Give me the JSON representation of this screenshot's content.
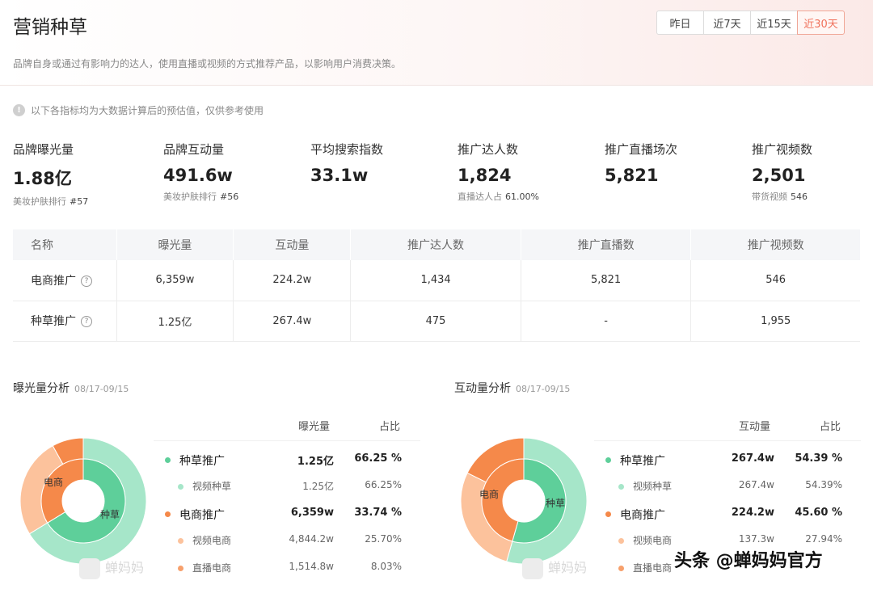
{
  "header": {
    "title": "营销种草",
    "subtitle": "品牌自身或通过有影响力的达人，使用直播或视频的方式推荐产品，以影响用户消费决策。",
    "range_tabs": [
      {
        "label": "昨日",
        "active": false
      },
      {
        "label": "近7天",
        "active": false
      },
      {
        "label": "近15天",
        "active": false
      },
      {
        "label": "近30天",
        "active": true
      }
    ]
  },
  "notice": "以下各指标均为大数据计算后的预估值，仅供参考使用",
  "metrics": [
    {
      "label": "品牌曝光量",
      "value": "1.88亿",
      "sub_label": "美妆护肤排行",
      "sub_value": "#57"
    },
    {
      "label": "品牌互动量",
      "value": "491.6w",
      "sub_label": "美妆护肤排行",
      "sub_value": "#56"
    },
    {
      "label": "平均搜索指数",
      "value": "33.1w",
      "sub_label": "",
      "sub_value": ""
    },
    {
      "label": "推广达人数",
      "value": "1,824",
      "sub_label": "直播达人占",
      "sub_value": "61.00%"
    },
    {
      "label": "推广直播场次",
      "value": "5,821",
      "sub_label": "",
      "sub_value": ""
    },
    {
      "label": "推广视频数",
      "value": "2,501",
      "sub_label": "带货视频",
      "sub_value": "546"
    }
  ],
  "table": {
    "headers": [
      "名称",
      "曝光量",
      "互动量",
      "推广达人数",
      "推广直播数",
      "推广视频数"
    ],
    "rows": [
      [
        "电商推广",
        "6,359w",
        "224.2w",
        "1,434",
        "5,821",
        "546"
      ],
      [
        "种草推广",
        "1.25亿",
        "267.4w",
        "475",
        "-",
        "1,955"
      ]
    ],
    "help_icon": "?"
  },
  "exposure": {
    "title": "曝光量分析",
    "date": "08/17-09/15",
    "col_value": "曝光量",
    "col_pct": "占比",
    "inner_label_a": "电商",
    "inner_label_b": "种草",
    "rows": [
      {
        "name": "种草推广",
        "value": "1.25亿",
        "pct": "66.25 %",
        "level": "main",
        "color": "#5ecf9a"
      },
      {
        "name": "视频种草",
        "value": "1.25亿",
        "pct": "66.25%",
        "level": "sub",
        "color": "#a6e6c9"
      },
      {
        "name": "电商推广",
        "value": "6,359w",
        "pct": "33.74 %",
        "level": "main",
        "color": "#f5894a"
      },
      {
        "name": "视频电商",
        "value": "4,844.2w",
        "pct": "25.70%",
        "level": "sub",
        "color": "#fcc29c"
      },
      {
        "name": "直播电商",
        "value": "1,514.8w",
        "pct": "8.03%",
        "level": "sub",
        "color": "#f7a06c"
      }
    ],
    "inner": [
      66.25,
      33.74
    ],
    "outer": [
      66.25,
      25.7,
      8.03
    ]
  },
  "interaction": {
    "title": "互动量分析",
    "date": "08/17-09/15",
    "col_value": "互动量",
    "col_pct": "占比",
    "inner_label_a": "电商",
    "inner_label_b": "种草",
    "rows": [
      {
        "name": "种草推广",
        "value": "267.4w",
        "pct": "54.39 %",
        "level": "main",
        "color": "#5ecf9a"
      },
      {
        "name": "视频种草",
        "value": "267.4w",
        "pct": "54.39%",
        "level": "sub",
        "color": "#a6e6c9"
      },
      {
        "name": "电商推广",
        "value": "224.2w",
        "pct": "45.60 %",
        "level": "main",
        "color": "#f5894a"
      },
      {
        "name": "视频电商",
        "value": "137.3w",
        "pct": "27.94%",
        "level": "sub",
        "color": "#fcc29c"
      },
      {
        "name": "直播电商",
        "value": "",
        "pct": "",
        "level": "sub",
        "color": "#f7a06c"
      }
    ],
    "inner": [
      54.39,
      45.6
    ],
    "outer": [
      54.39,
      27.94,
      17.66
    ]
  },
  "watermark": "蝉妈妈",
  "toutiao_mark": "头条 @蝉妈妈官方",
  "colors": {
    "accent": "#f0705a",
    "green": "#5ecf9a",
    "green_light": "#a6e6c9",
    "orange": "#f5894a",
    "orange_light": "#fcc29c"
  }
}
